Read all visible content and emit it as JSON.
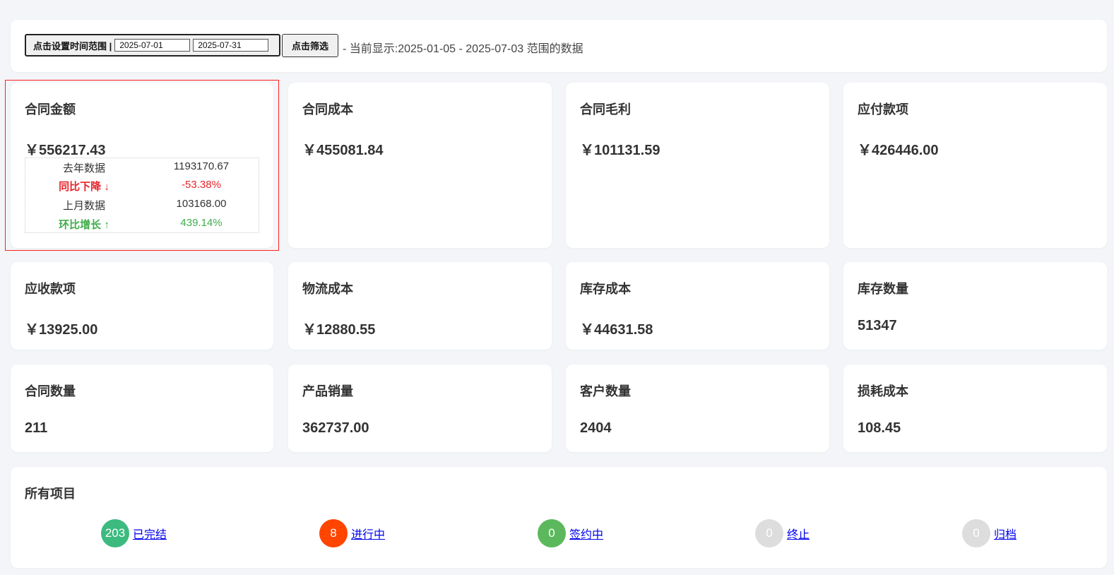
{
  "filter": {
    "range_button_label": "点击设置时间范围 |",
    "start_date": "2025-07-01",
    "end_date": "2025-07-31",
    "filter_button_label": "点击筛选",
    "current_range_text": "- 当前显示:2025-01-05 - 2025-07-03 范围的数据"
  },
  "cards": [
    {
      "title": "合同金额",
      "value": "￥556217.43",
      "compare": {
        "last_year_label": "去年数据",
        "last_year_value": "1193170.67",
        "yoy_label": "同比下降 ↓",
        "yoy_value": "-53.38%",
        "last_month_label": "上月数据",
        "last_month_value": "103168.00",
        "mom_label": "环比增长 ↑",
        "mom_value": "439.14%"
      }
    },
    {
      "title": "合同成本",
      "value": "￥455081.84"
    },
    {
      "title": "合同毛利",
      "value": "￥101131.59"
    },
    {
      "title": "应付款项",
      "value": "￥426446.00"
    },
    {
      "title": "应收款项",
      "value": "￥13925.00"
    },
    {
      "title": "物流成本",
      "value": "￥12880.55"
    },
    {
      "title": "库存成本",
      "value": "￥44631.58"
    },
    {
      "title": "库存数量",
      "value": "51347"
    },
    {
      "title": "合同数量",
      "value": "211"
    },
    {
      "title": "产品销量",
      "value": "362737.00"
    },
    {
      "title": "客户数量",
      "value": "2404"
    },
    {
      "title": "损耗成本",
      "value": "108.45"
    }
  ],
  "projects": {
    "title": "所有项目",
    "statuses": [
      {
        "count": "203",
        "label": "已完结",
        "color": "#3dba7f"
      },
      {
        "count": "8",
        "label": "进行中",
        "color": "#ff4500"
      },
      {
        "count": "0",
        "label": "签约中",
        "color": "#5cb85c"
      },
      {
        "count": "0",
        "label": "终止",
        "color": "#dddddd"
      },
      {
        "count": "0",
        "label": "归档",
        "color": "#dddddd"
      }
    ]
  },
  "colors": {
    "decrease": "#e8242a",
    "increase": "#3fae49",
    "highlight_border": "#ff2020",
    "link": "#0000ee"
  }
}
